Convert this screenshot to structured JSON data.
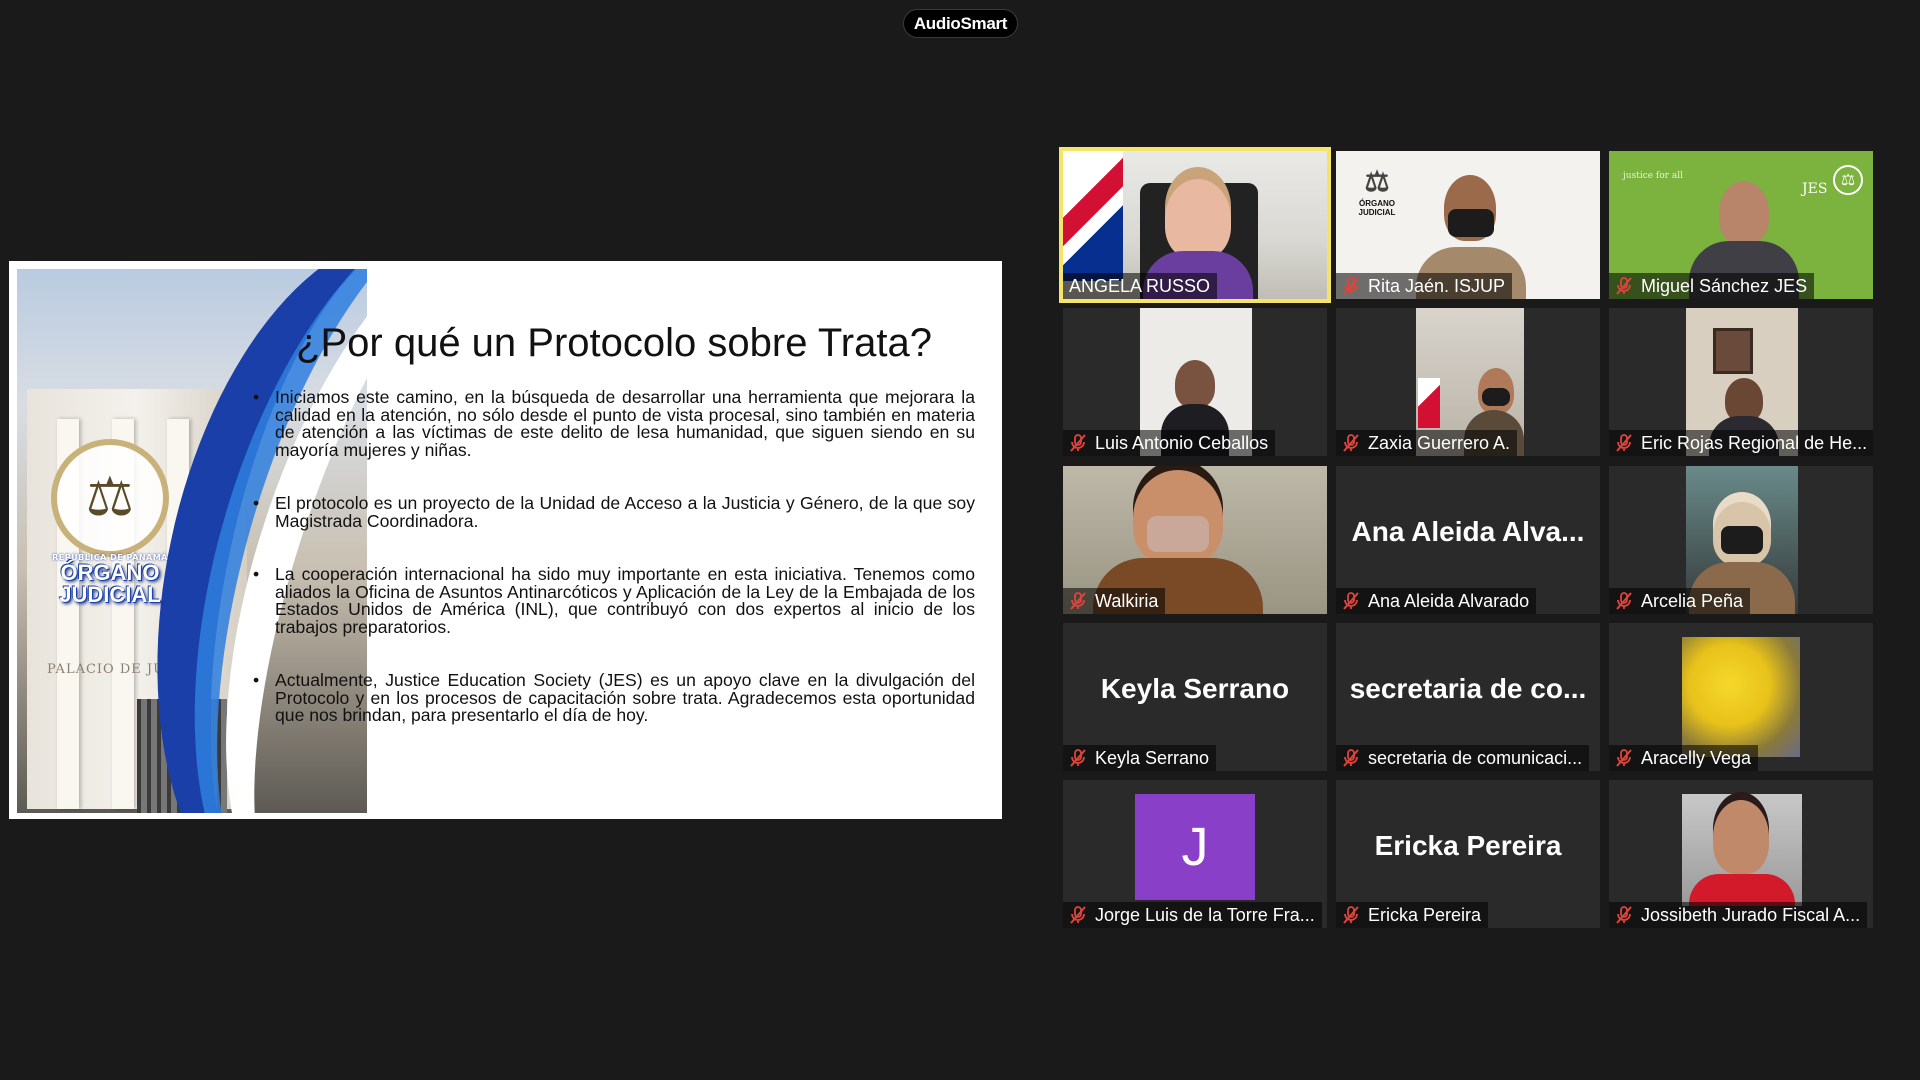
{
  "app": {
    "badge": "AudioSmart"
  },
  "slide": {
    "title": "¿Por qué un Protocolo sobre Trata?",
    "logo_small": "REPÚBLICA DE PANAMÁ",
    "logo_line1": "ÓRGANO",
    "logo_line2": "JUDICIAL",
    "building_sign": "PALACIO DE JUST",
    "bullets": [
      "Iniciamos este camino, en la búsqueda de desarrollar una herramienta que mejorara la calidad en la atención, no sólo desde el punto de vista procesal, sino también en materia de atención a las víctimas de este delito de lesa humanidad, que siguen siendo en su mayoría mujeres y niñas.",
      "El protocolo es un proyecto de la Unidad de Acceso a la Justicia y Género, de la que soy Magistrada Coordinadora.",
      "La cooperación internacional ha sido muy importante en esta iniciativa. Tenemos como aliados la Oficina de Asuntos Antinarcóticos y Aplicación de la Ley de la Embajada de los Estados Unidos de América (INL), que contribuyó con dos expertos al inicio de los trabajos preparatorios.",
      "Actualmente, Justice Education Society (JES) es un apoyo clave en la divulgación del Protocolo y en los procesos de capacitación sobre trata. Agradecemos esta oportunidad que nos brindan, para presentarlo el día de hoy."
    ]
  },
  "participants": [
    {
      "name": "ANGELA RUSSO",
      "muted": false,
      "active": true
    },
    {
      "name": "Rita Jaén. ISJUP",
      "muted": true,
      "logo_text": "ÓRGANO JUDICIAL"
    },
    {
      "name": "Miguel Sánchez JES",
      "muted": true,
      "logo_text": "JES",
      "tagline": "justice for all"
    },
    {
      "name": "Luis Antonio Ceballos",
      "muted": true
    },
    {
      "name": "Zaxia Guerrero A.",
      "muted": true
    },
    {
      "name": "Eric Rojas Regional de He...",
      "muted": true
    },
    {
      "name": "Walkiria",
      "muted": true
    },
    {
      "name": "Ana Aleida Alvarado",
      "muted": true,
      "display": "Ana Aleida Alva..."
    },
    {
      "name": "Arcelia Peña",
      "muted": true
    },
    {
      "name": "Keyla Serrano",
      "muted": true,
      "display": "Keyla Serrano"
    },
    {
      "name": "secretaria de comunicaci...",
      "muted": true,
      "display": "secretaria de co..."
    },
    {
      "name": "Aracelly Vega",
      "muted": true
    },
    {
      "name": "Jorge Luis de la Torre Fra...",
      "muted": true,
      "avatar_letter": "J"
    },
    {
      "name": "Ericka Pereira",
      "muted": true,
      "display": "Ericka Pereira"
    },
    {
      "name": "Jossibeth Jurado Fiscal A...",
      "muted": true
    }
  ],
  "colors": {
    "active_border": "#f5e46a",
    "mic_muted": "#e0433b",
    "avatar_bg": "#8a3fc9",
    "jes_green": "#7bb33e"
  }
}
